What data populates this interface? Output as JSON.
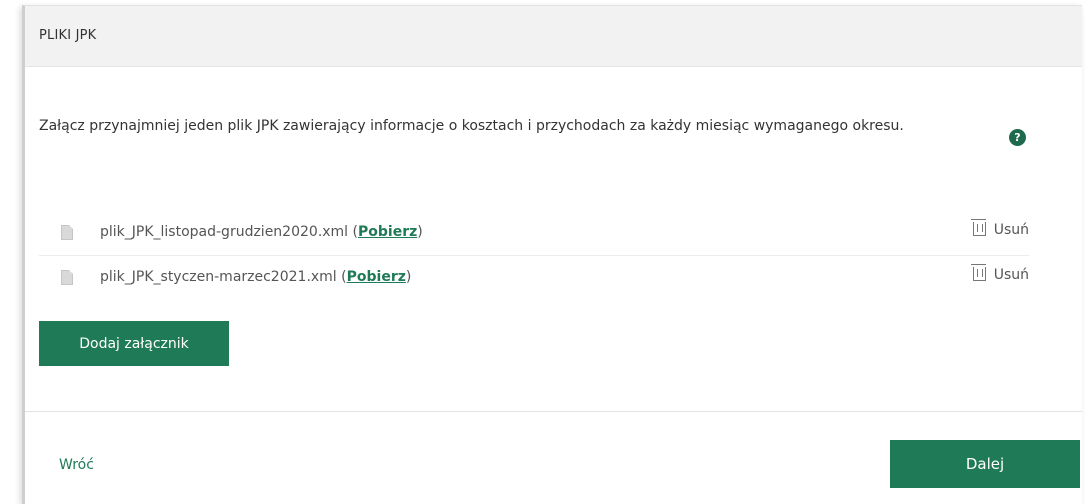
{
  "header": {
    "title": "PLIKI JPK"
  },
  "intro": {
    "text": "Załącz przynajmniej jeden plik JPK zawierający informacje o kosztach i przychodach za każdy miesiąc wymaganego okresu."
  },
  "help": {
    "glyph": "?",
    "icon": "question-circle-icon",
    "color": "#1f6a4e"
  },
  "files": [
    {
      "name": "plik_JPK_listopad-grudzien2020.xml",
      "open": " (",
      "download": "Pobierz",
      "close": ")",
      "remove": "Usuń"
    },
    {
      "name": "plik_JPK_styczen-marzec2021.xml",
      "open": " (",
      "download": "Pobierz",
      "close": ")",
      "remove": "Usuń"
    }
  ],
  "actions": {
    "add_attachment": "Dodaj załącznik",
    "back": "Wróć",
    "next": "Dalej"
  },
  "colors": {
    "accent": "#1f7a57",
    "header_bg": "#f2f2f2"
  }
}
